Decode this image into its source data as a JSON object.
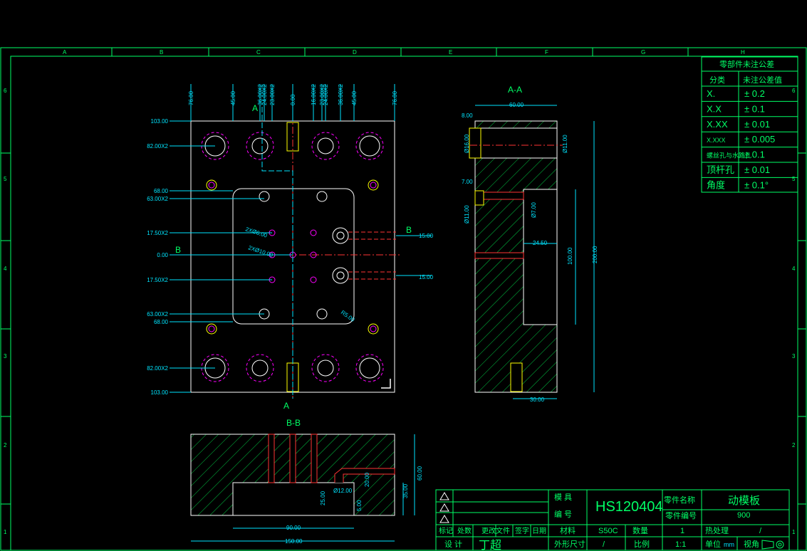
{
  "drawing": {
    "grid_cols": [
      "A",
      "B",
      "C",
      "D",
      "E",
      "F",
      "G",
      "H"
    ],
    "grid_rows": [
      "6",
      "5",
      "4",
      "3",
      "2",
      "1"
    ],
    "section_labels": {
      "aa_top": "A",
      "aa_bottom": "A",
      "bb_left": "B",
      "bb_right": "B",
      "view_aa": "A-A",
      "view_bb": "B-B"
    },
    "plan_dims": {
      "left": [
        "103.00",
        "82.00X2",
        "68.00",
        "63.00X2",
        "17.50X2",
        "0.00",
        "17.50X2",
        "63.00X2",
        "68.00",
        "82.00X2",
        "103.00"
      ],
      "top": [
        "76.00",
        "45.00",
        "36.00X2",
        "24.00X2",
        "23.00X2",
        "0.00",
        "16.00X2",
        "23.00X2",
        "24.00X2",
        "36.00X2",
        "45.00",
        "76.00"
      ],
      "right": [
        "15.00",
        "15.00"
      ],
      "inner": [
        "2XØ6.00",
        "2XØ10.00",
        "R5.00"
      ]
    },
    "aa_dims": {
      "width": "60.00",
      "height": "200.00",
      "t1": "8.00",
      "d1": "Ø16.00",
      "d2": "Ø11.00",
      "t2": "7.00",
      "d3": "Ø11.00",
      "d4": "Ø7.00",
      "w2": "24.50",
      "h2": "100.00",
      "bottom": "30.00"
    },
    "bb_dims": {
      "h1": "60.00",
      "h2": "35.00",
      "d1": "Ø12.00",
      "d2": "25.00",
      "d3": "5.00",
      "d4": "20.00",
      "w1": "90.00",
      "w2": "150.00"
    }
  },
  "tolerance_table": {
    "title": "零部件未注公差",
    "headers": [
      "分类",
      "未注公差值"
    ],
    "rows": [
      [
        "X.",
        "± 0.2"
      ],
      [
        "X.X",
        "± 0.1"
      ],
      [
        "X.XX",
        "± 0.01"
      ],
      [
        "X.XXX",
        "± 0.005"
      ],
      [
        "螺丝孔与水路孔",
        "± 0.1"
      ],
      [
        "顶杆孔",
        "± 0.01"
      ],
      [
        "角度",
        "± 0.1°"
      ]
    ]
  },
  "title_block": {
    "mold_no_label": "模 具\n编 号",
    "mold_no": "HS120404",
    "part_name_label": "零件名称",
    "part_name": "动模板",
    "part_no_label": "零件编号",
    "part_no": "900",
    "rev_headers": [
      "标记",
      "处数",
      "更改文件",
      "签字",
      "日期"
    ],
    "material_label": "材料",
    "material": "S50C",
    "qty_label": "数量",
    "qty": "1",
    "heat_label": "热处理",
    "heat": "/",
    "design_label": "设 计",
    "designer": "丁超",
    "size_label": "外形尺寸",
    "size": "/",
    "scale_label": "比例",
    "scale": "1:1",
    "unit_label": "单位",
    "unit": "mm",
    "view_label": "视角"
  },
  "colors": {
    "background": "#000000",
    "frame": "#00ff66",
    "dim": "#00e5ff",
    "hole": "#ff00ff",
    "center": "#ff3333",
    "hatch": "#00cc44",
    "outline": "#ffffff"
  }
}
